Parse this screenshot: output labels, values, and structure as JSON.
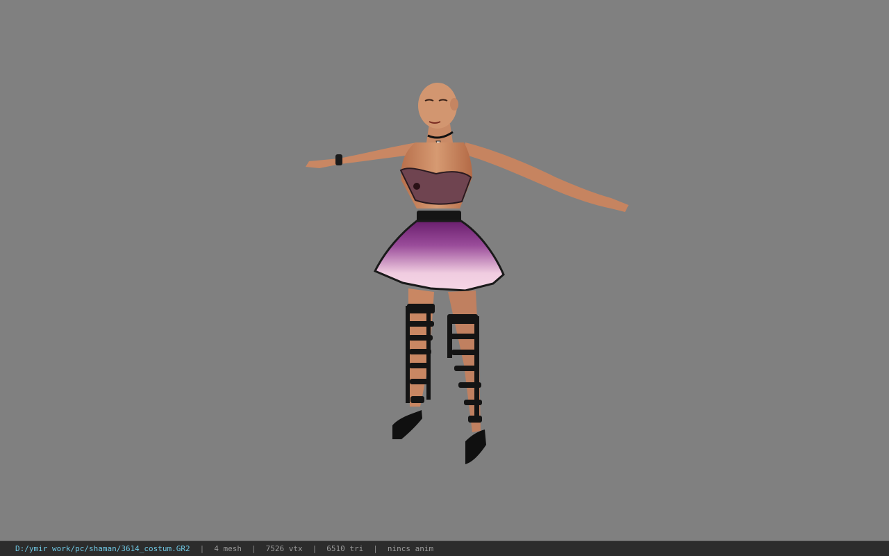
{
  "viewer": {
    "background_color": "#808080",
    "model": {
      "description_icon": "character-model-icon",
      "skirt_color": "#8b3f8a"
    }
  },
  "statusbar": {
    "file_path": "D:/ymir work/pc/shaman/3614_costum.GR2",
    "separator": "|",
    "mesh_count": "4 mesh",
    "vertex_count": "7526 vtx",
    "triangle_count": "6510 tri",
    "animation_status": "nincs anim"
  }
}
